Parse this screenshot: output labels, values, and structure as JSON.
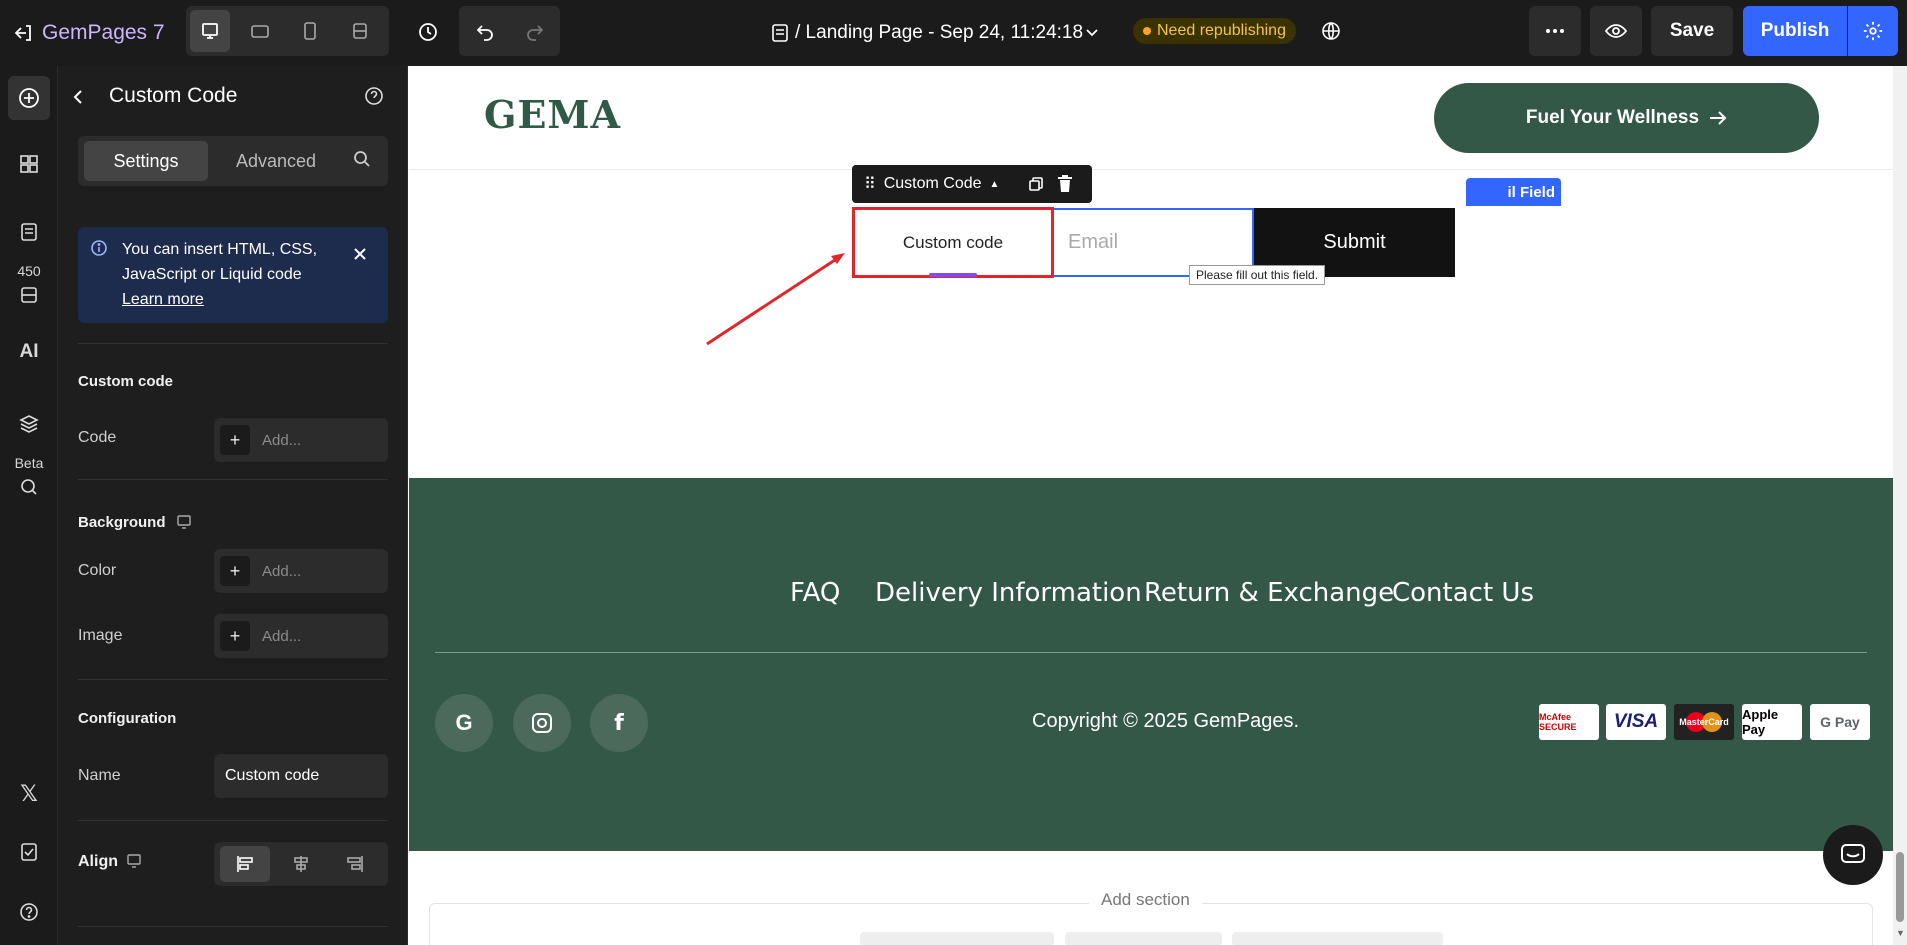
{
  "app": {
    "name": "GemPages 7"
  },
  "page": {
    "breadcrumb": "/ Landing Page - Sep 24, 11:24:18",
    "status": "Need republishing"
  },
  "toolbar": {
    "save": "Save",
    "publish": "Publish"
  },
  "rail": {
    "badge": "450",
    "ai": "AI",
    "beta": "Beta"
  },
  "panel": {
    "title": "Custom Code",
    "tabs": [
      "Settings",
      "Advanced"
    ],
    "info": {
      "text": "You can insert HTML, CSS, JavaScript or Liquid code",
      "link": "Learn more"
    },
    "custom_code_section": "Custom code",
    "code_label": "Code",
    "add": "Add...",
    "background_section": "Background",
    "color_label": "Color",
    "image_label": "Image",
    "configuration_section": "Configuration",
    "name_label": "Name",
    "name_value": "Custom code",
    "align_label": "Align"
  },
  "canvas": {
    "logo": "GEMA",
    "cta": "Fuel Your Wellness",
    "toolbar_label": "Custom Code",
    "email_field_tag": "il Field",
    "custom_code_text": "Custom code",
    "email_placeholder": "Email",
    "submit": "Submit",
    "tooltip": "Please fill out this field.",
    "footer_links": [
      "FAQ",
      "Delivery Information",
      "Return & Exchange",
      "Contact Us"
    ],
    "copyright": "Copyright © 2025 GemPages.",
    "payments": [
      "McAfee SECURE",
      "VISA",
      "MasterCard",
      "Apple Pay",
      "G Pay"
    ],
    "add_section": "Add section"
  },
  "colors": {
    "accent": "#3366ff",
    "green": "#335848",
    "dark": "#1b1b1b"
  }
}
